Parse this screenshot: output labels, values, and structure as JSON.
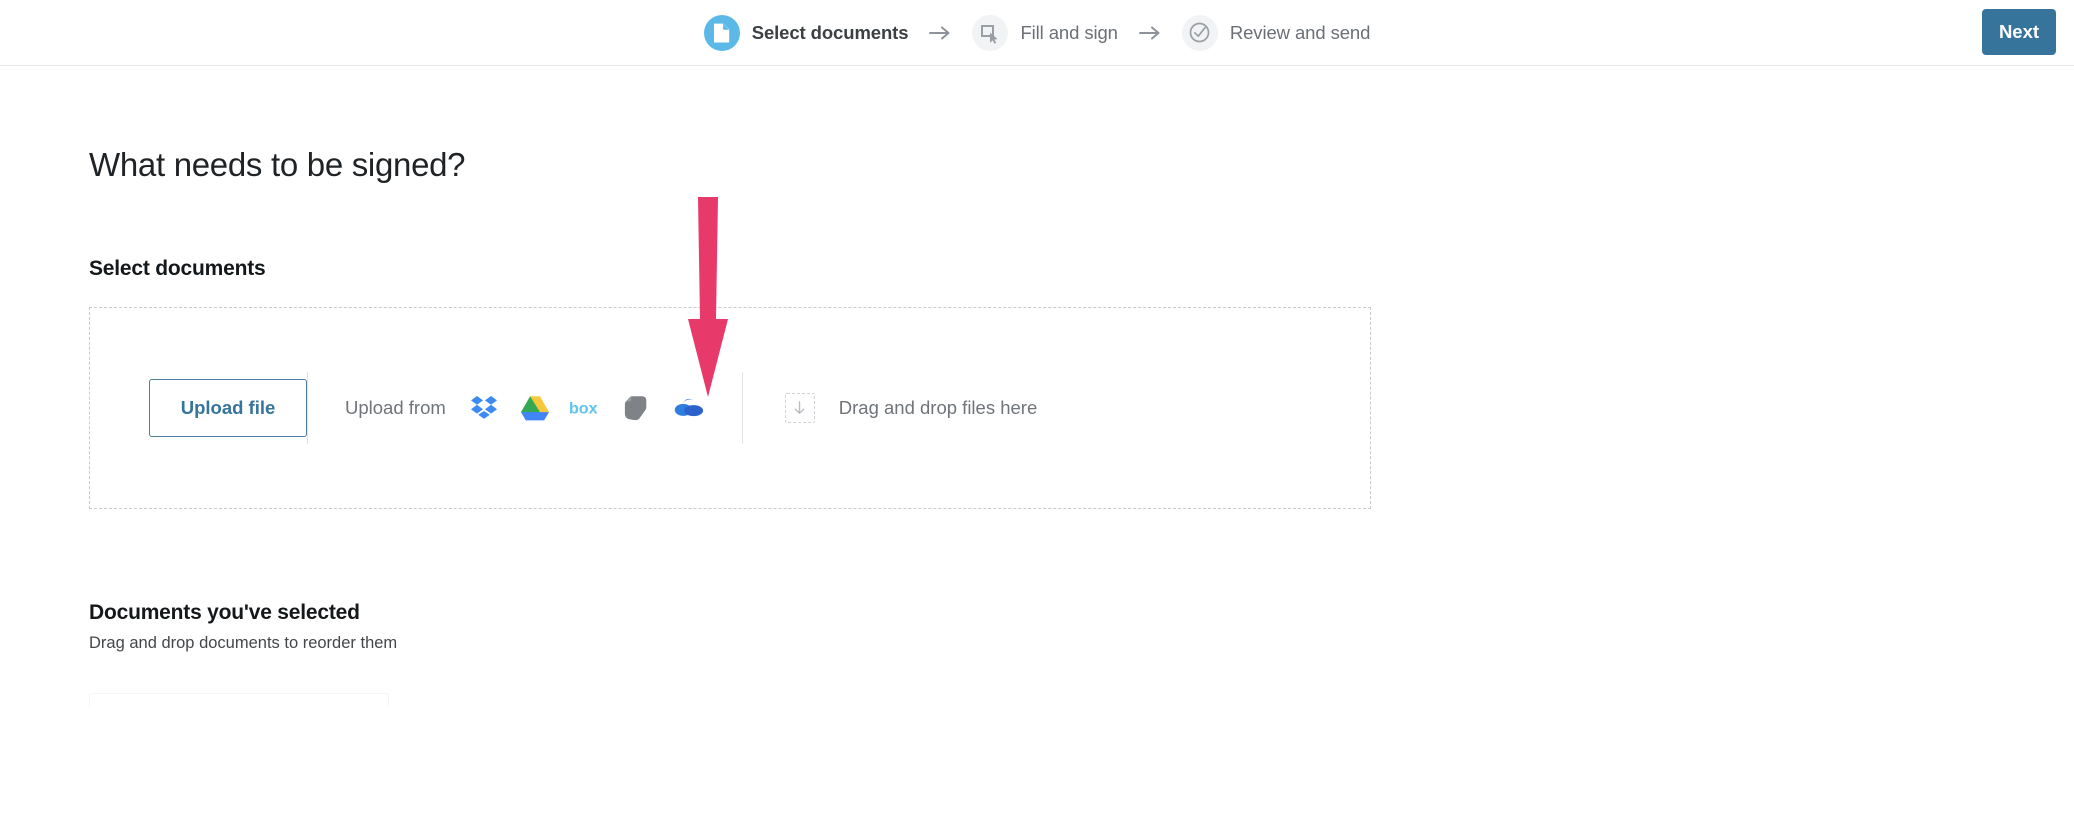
{
  "header": {
    "steps": [
      {
        "id": "select-documents",
        "label": "Select documents",
        "icon": "document-icon",
        "state": "active"
      },
      {
        "id": "fill-and-sign",
        "label": "Fill and sign",
        "icon": "cursor-select-icon",
        "state": "inactive"
      },
      {
        "id": "review-and-send",
        "label": "Review and send",
        "icon": "check-circle-icon",
        "state": "inactive"
      }
    ],
    "separator_icon": "arrow-right-icon",
    "next_label": "Next"
  },
  "main": {
    "page_title": "What needs to be signed?",
    "section_title": "Select documents",
    "upload": {
      "upload_file_label": "Upload file",
      "upload_from_label": "Upload from",
      "providers": [
        {
          "id": "dropbox",
          "name": "dropbox-icon"
        },
        {
          "id": "googledrive",
          "name": "google-drive-icon"
        },
        {
          "id": "box",
          "name": "box-icon"
        },
        {
          "id": "evernote",
          "name": "evernote-icon"
        },
        {
          "id": "onedrive",
          "name": "onedrive-icon"
        }
      ],
      "drop_icon": "download-arrow-icon",
      "drop_label": "Drag and drop files here"
    },
    "selected": {
      "title": "Documents you've selected",
      "subtitle": "Drag and drop documents to reorder them"
    }
  },
  "annotation": {
    "arrow_icon": "arrow-down-annotation",
    "color": "#e8396b",
    "points_at": "evernote-icon"
  },
  "colors": {
    "active_step": "#5bb9e8",
    "inactive_step": "#f2f3f5",
    "next_button": "#36749c",
    "upload_button_text": "#36749c",
    "annotation": "#e8396b"
  }
}
